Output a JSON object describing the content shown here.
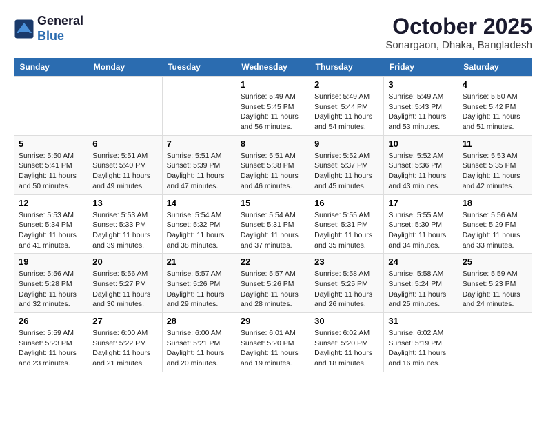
{
  "header": {
    "logo_line1": "General",
    "logo_line2": "Blue",
    "month": "October 2025",
    "location": "Sonargaon, Dhaka, Bangladesh"
  },
  "weekdays": [
    "Sunday",
    "Monday",
    "Tuesday",
    "Wednesday",
    "Thursday",
    "Friday",
    "Saturday"
  ],
  "weeks": [
    [
      {
        "day": "",
        "info": ""
      },
      {
        "day": "",
        "info": ""
      },
      {
        "day": "",
        "info": ""
      },
      {
        "day": "1",
        "info": "Sunrise: 5:49 AM\nSunset: 5:45 PM\nDaylight: 11 hours\nand 56 minutes."
      },
      {
        "day": "2",
        "info": "Sunrise: 5:49 AM\nSunset: 5:44 PM\nDaylight: 11 hours\nand 54 minutes."
      },
      {
        "day": "3",
        "info": "Sunrise: 5:49 AM\nSunset: 5:43 PM\nDaylight: 11 hours\nand 53 minutes."
      },
      {
        "day": "4",
        "info": "Sunrise: 5:50 AM\nSunset: 5:42 PM\nDaylight: 11 hours\nand 51 minutes."
      }
    ],
    [
      {
        "day": "5",
        "info": "Sunrise: 5:50 AM\nSunset: 5:41 PM\nDaylight: 11 hours\nand 50 minutes."
      },
      {
        "day": "6",
        "info": "Sunrise: 5:51 AM\nSunset: 5:40 PM\nDaylight: 11 hours\nand 49 minutes."
      },
      {
        "day": "7",
        "info": "Sunrise: 5:51 AM\nSunset: 5:39 PM\nDaylight: 11 hours\nand 47 minutes."
      },
      {
        "day": "8",
        "info": "Sunrise: 5:51 AM\nSunset: 5:38 PM\nDaylight: 11 hours\nand 46 minutes."
      },
      {
        "day": "9",
        "info": "Sunrise: 5:52 AM\nSunset: 5:37 PM\nDaylight: 11 hours\nand 45 minutes."
      },
      {
        "day": "10",
        "info": "Sunrise: 5:52 AM\nSunset: 5:36 PM\nDaylight: 11 hours\nand 43 minutes."
      },
      {
        "day": "11",
        "info": "Sunrise: 5:53 AM\nSunset: 5:35 PM\nDaylight: 11 hours\nand 42 minutes."
      }
    ],
    [
      {
        "day": "12",
        "info": "Sunrise: 5:53 AM\nSunset: 5:34 PM\nDaylight: 11 hours\nand 41 minutes."
      },
      {
        "day": "13",
        "info": "Sunrise: 5:53 AM\nSunset: 5:33 PM\nDaylight: 11 hours\nand 39 minutes."
      },
      {
        "day": "14",
        "info": "Sunrise: 5:54 AM\nSunset: 5:32 PM\nDaylight: 11 hours\nand 38 minutes."
      },
      {
        "day": "15",
        "info": "Sunrise: 5:54 AM\nSunset: 5:31 PM\nDaylight: 11 hours\nand 37 minutes."
      },
      {
        "day": "16",
        "info": "Sunrise: 5:55 AM\nSunset: 5:31 PM\nDaylight: 11 hours\nand 35 minutes."
      },
      {
        "day": "17",
        "info": "Sunrise: 5:55 AM\nSunset: 5:30 PM\nDaylight: 11 hours\nand 34 minutes."
      },
      {
        "day": "18",
        "info": "Sunrise: 5:56 AM\nSunset: 5:29 PM\nDaylight: 11 hours\nand 33 minutes."
      }
    ],
    [
      {
        "day": "19",
        "info": "Sunrise: 5:56 AM\nSunset: 5:28 PM\nDaylight: 11 hours\nand 32 minutes."
      },
      {
        "day": "20",
        "info": "Sunrise: 5:56 AM\nSunset: 5:27 PM\nDaylight: 11 hours\nand 30 minutes."
      },
      {
        "day": "21",
        "info": "Sunrise: 5:57 AM\nSunset: 5:26 PM\nDaylight: 11 hours\nand 29 minutes."
      },
      {
        "day": "22",
        "info": "Sunrise: 5:57 AM\nSunset: 5:26 PM\nDaylight: 11 hours\nand 28 minutes."
      },
      {
        "day": "23",
        "info": "Sunrise: 5:58 AM\nSunset: 5:25 PM\nDaylight: 11 hours\nand 26 minutes."
      },
      {
        "day": "24",
        "info": "Sunrise: 5:58 AM\nSunset: 5:24 PM\nDaylight: 11 hours\nand 25 minutes."
      },
      {
        "day": "25",
        "info": "Sunrise: 5:59 AM\nSunset: 5:23 PM\nDaylight: 11 hours\nand 24 minutes."
      }
    ],
    [
      {
        "day": "26",
        "info": "Sunrise: 5:59 AM\nSunset: 5:23 PM\nDaylight: 11 hours\nand 23 minutes."
      },
      {
        "day": "27",
        "info": "Sunrise: 6:00 AM\nSunset: 5:22 PM\nDaylight: 11 hours\nand 21 minutes."
      },
      {
        "day": "28",
        "info": "Sunrise: 6:00 AM\nSunset: 5:21 PM\nDaylight: 11 hours\nand 20 minutes."
      },
      {
        "day": "29",
        "info": "Sunrise: 6:01 AM\nSunset: 5:20 PM\nDaylight: 11 hours\nand 19 minutes."
      },
      {
        "day": "30",
        "info": "Sunrise: 6:02 AM\nSunset: 5:20 PM\nDaylight: 11 hours\nand 18 minutes."
      },
      {
        "day": "31",
        "info": "Sunrise: 6:02 AM\nSunset: 5:19 PM\nDaylight: 11 hours\nand 16 minutes."
      },
      {
        "day": "",
        "info": ""
      }
    ]
  ]
}
